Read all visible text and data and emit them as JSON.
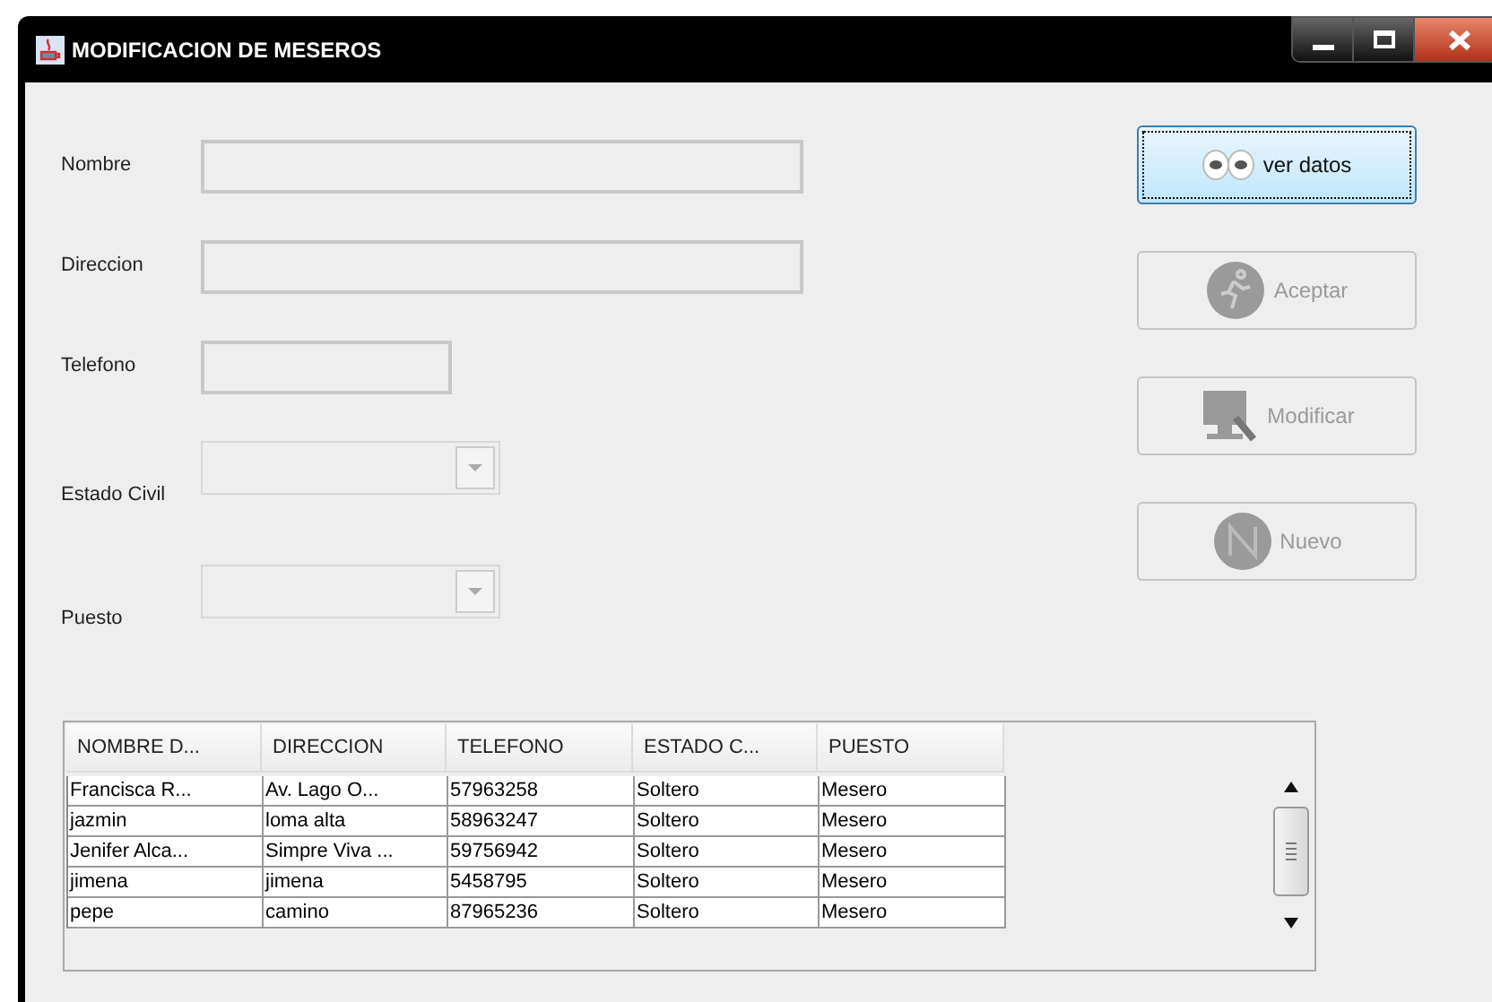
{
  "window": {
    "title": "MODIFICACION DE MESEROS"
  },
  "fields": [
    {
      "label": "Nombre",
      "kind": "text"
    },
    {
      "label": "Direccion",
      "kind": "text"
    },
    {
      "label": "Telefono",
      "kind": "text"
    },
    {
      "label": "Estado Civil",
      "kind": "combo"
    },
    {
      "label": "Puesto",
      "kind": "combo"
    }
  ],
  "buttons": [
    {
      "label": "ver datos",
      "disabled": false,
      "focused": true
    },
    {
      "label": "Aceptar",
      "disabled": true,
      "focused": false
    },
    {
      "label": "Modificar",
      "disabled": true,
      "focused": false
    },
    {
      "label": "Nuevo",
      "disabled": true,
      "focused": false
    }
  ],
  "table": {
    "columns": [
      "NOMBRE D...",
      "DIRECCION",
      "TELEFONO",
      "ESTADO C...",
      "PUESTO"
    ],
    "rows": [
      [
        "Francisca R...",
        "Av. Lago O...",
        "57963258",
        "Soltero",
        "Mesero"
      ],
      [
        "jazmin",
        "loma alta",
        "58963247",
        "Soltero",
        "Mesero"
      ],
      [
        "Jenifer Alca...",
        "Simpre Viva ...",
        "59756942",
        "Soltero",
        "Mesero"
      ],
      [
        "jimena",
        "jimena",
        "5458795",
        "Soltero",
        "Mesero"
      ],
      [
        "pepe",
        "camino",
        "87965236",
        "Soltero",
        "Mesero"
      ]
    ]
  }
}
